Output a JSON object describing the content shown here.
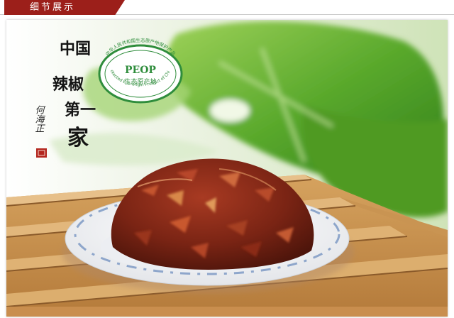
{
  "header": {
    "title": "细节展示"
  },
  "photo": {
    "slogan": [
      "中国",
      "辣椒",
      "第一",
      "家"
    ],
    "signature": "何海正",
    "badge": {
      "code": "PEOP",
      "name_cn": "生态原产地",
      "ring_cn": "中华人民共和国生态原产地保护产品",
      "ring_en": "Protected Eco-origin Product of China"
    }
  },
  "colors": {
    "header": "#9c1f1a",
    "badge_green": "#2f8d3c",
    "seal_red": "#b3261e"
  }
}
